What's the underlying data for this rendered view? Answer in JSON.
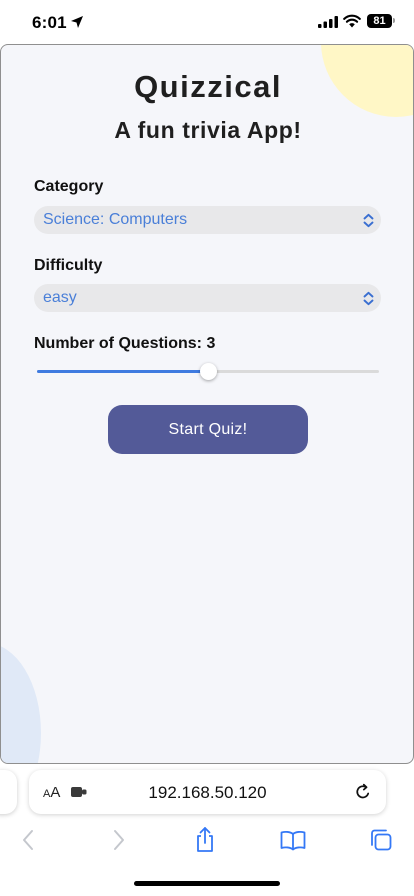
{
  "status_bar": {
    "time": "6:01",
    "battery": "81",
    "icons": [
      "location-arrow-icon",
      "signal-icon",
      "wifi-icon",
      "battery-icon"
    ]
  },
  "app": {
    "title": "Quizzical",
    "subtitle": "A fun trivia App!",
    "category": {
      "label": "Category",
      "selected": "Science: Computers"
    },
    "difficulty": {
      "label": "Difficulty",
      "selected": "easy"
    },
    "questions": {
      "label": "Number of Questions: 3",
      "slider_fraction": 0.5
    },
    "start_button": "Start Quiz!"
  },
  "browser": {
    "text_size_button": "AA",
    "url": "192.168.50.120",
    "toolbar_icons": [
      "back-icon",
      "forward-icon",
      "share-icon",
      "bookmarks-icon",
      "tabs-icon"
    ]
  },
  "colors": {
    "page_background": "#f5f6fa",
    "accent": "#535a98",
    "select_text": "#4a7fd8",
    "slider_fill": "#3f7be0",
    "browser_tint": "#3478f6"
  }
}
